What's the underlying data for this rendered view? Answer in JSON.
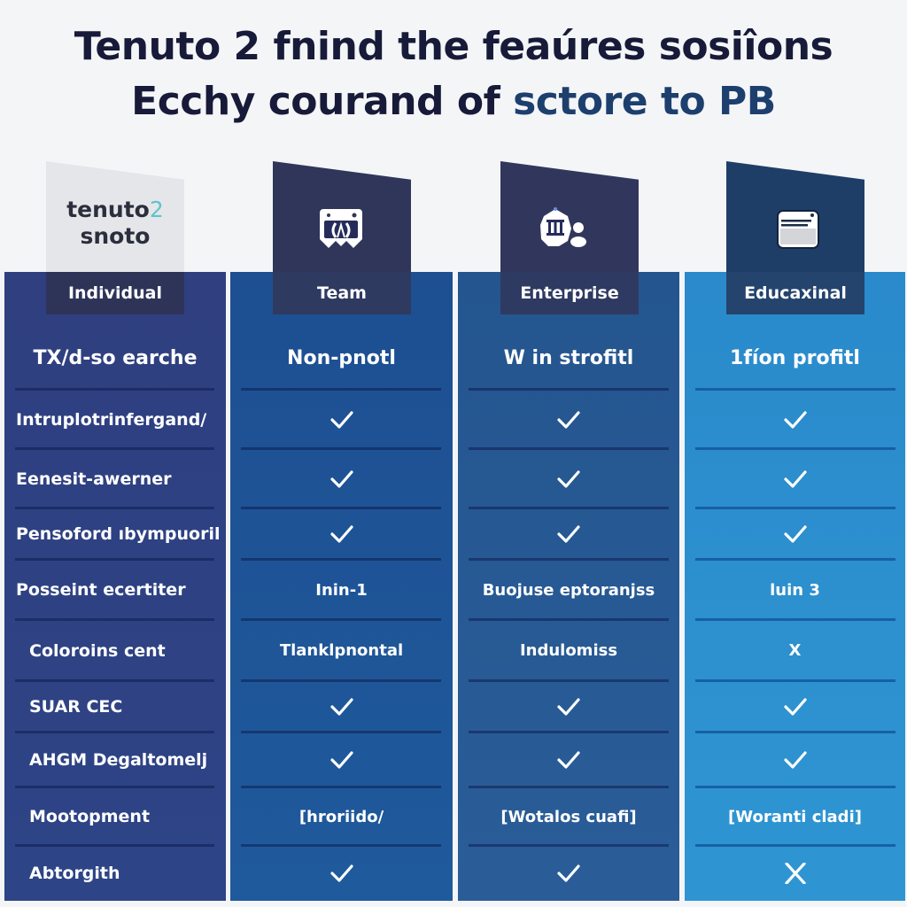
{
  "title": {
    "line1": "Tenuto  2 fnind the feaúres sosiîons",
    "line2_main": "Ecchy courand of ",
    "line2_accent": "sctore to PB"
  },
  "brand": {
    "line1_text": "tenuto",
    "line1_number": "2",
    "line2": "snoto"
  },
  "plans": [
    {
      "name": "Individual",
      "icon": "brand-logo"
    },
    {
      "name": "Team",
      "icon": "team-badge-icon"
    },
    {
      "name": "Enterprise",
      "icon": "institution-users-icon"
    },
    {
      "name": "Educaxinal",
      "icon": "browser-window-icon"
    }
  ],
  "rows": [
    {
      "feature": "TX/d-so earche",
      "values": [
        {
          "type": "text",
          "text": "Non-pnotl"
        },
        {
          "type": "text",
          "text": "W in strofitl"
        },
        {
          "type": "text",
          "text": "1fíon profitl"
        }
      ]
    },
    {
      "feature": "Intruplotrinfergand/",
      "values": [
        {
          "type": "check"
        },
        {
          "type": "check"
        },
        {
          "type": "check"
        }
      ]
    },
    {
      "feature": "Eenesit-awerner",
      "values": [
        {
          "type": "check"
        },
        {
          "type": "check"
        },
        {
          "type": "check"
        }
      ]
    },
    {
      "feature": "Pensoford ıbympuoril",
      "values": [
        {
          "type": "check"
        },
        {
          "type": "check"
        },
        {
          "type": "check"
        }
      ]
    },
    {
      "feature": "Posseint ecertiter",
      "values": [
        {
          "type": "text",
          "text": "Inin-1"
        },
        {
          "type": "text",
          "text": "Buojuse eptoranjss"
        },
        {
          "type": "text",
          "text": "luin 3"
        }
      ]
    },
    {
      "feature": "Coloroins cent",
      "values": [
        {
          "type": "text",
          "text": "Tlanklpnontal"
        },
        {
          "type": "text",
          "text": "Indulomiss"
        },
        {
          "type": "text",
          "text": "X"
        }
      ]
    },
    {
      "feature": "SUAR CEC",
      "values": [
        {
          "type": "check"
        },
        {
          "type": "check"
        },
        {
          "type": "check"
        }
      ]
    },
    {
      "feature": "AHGM Degaltomelj",
      "values": [
        {
          "type": "check"
        },
        {
          "type": "check"
        },
        {
          "type": "check"
        }
      ]
    },
    {
      "feature": "Mootopment",
      "values": [
        {
          "type": "text",
          "text": "[hroriido/"
        },
        {
          "type": "text",
          "text": "[Wotalos cuafi]"
        },
        {
          "type": "text",
          "text": "[Woranti cladi]"
        }
      ]
    },
    {
      "feature": "Abtorgith",
      "values": [
        {
          "type": "check"
        },
        {
          "type": "check"
        },
        {
          "type": "cross"
        }
      ]
    }
  ],
  "colors": {
    "title_text": "#171a38",
    "title_accent": "#1d3f6e",
    "individual_column": "#2e4282",
    "team_column": "#1e5597",
    "enterprise_column": "#275a94",
    "education_column": "#2c8fce",
    "brand_accent": "#5ec4c9"
  }
}
